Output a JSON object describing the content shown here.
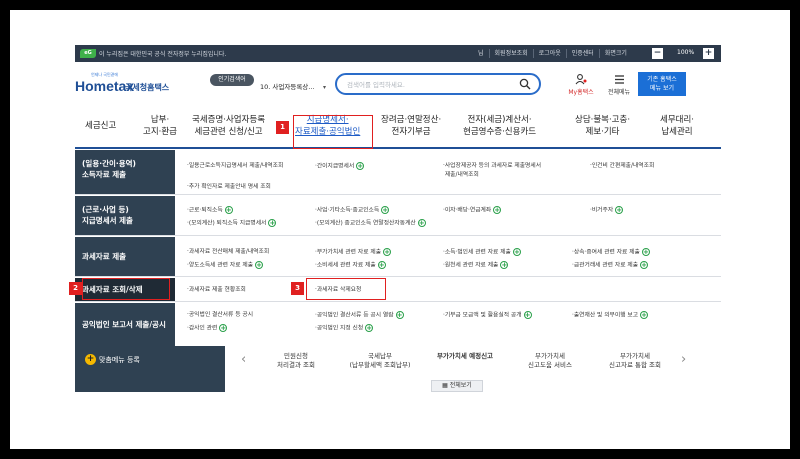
{
  "gov_bar": {
    "logo": "eG",
    "notice": "이 누리집은 대한민국 공식 전자정부 누리집입니다.",
    "links": [
      "님",
      "회원정보조회",
      "로그아웃",
      "인증센터",
      "화면크기"
    ],
    "zoom_minus": "−",
    "zoom_value": "100%",
    "zoom_plus": "+"
  },
  "header": {
    "logo_text": "Hometax",
    "logo_sub": "국세청홈택스",
    "logo_tiny": "언제나 국민곁에",
    "popular_label": "인기검색어",
    "popular_keyword": "10. 사업자등록상...",
    "search_placeholder": "검색어를 입력하세요.",
    "my_label": "My홈택스",
    "menu_label": "전체메뉴",
    "tax_btn_line1": "기존 홈택스",
    "tax_btn_line2": "메뉴 보기"
  },
  "gnb": [
    {
      "l1": "세금신고",
      "l2": ""
    },
    {
      "l1": "납부·",
      "l2": "고지·환급"
    },
    {
      "l1": "국세증명·사업자등록",
      "l2": "세금관련 신청/신고"
    },
    {
      "l1": "지급명세서·",
      "l2": "자료제출·공익법인"
    },
    {
      "l1": "장려금·연말정산·",
      "l2": "전자기부금"
    },
    {
      "l1": "전자(세금)계산서·",
      "l2": "현금영수증·신용카드"
    },
    {
      "l1": "상담·불복·고충·",
      "l2": "제보·기타"
    },
    {
      "l1": "세무대리·",
      "l2": "납세관리"
    }
  ],
  "badges": {
    "b1": "1",
    "b2": "2",
    "b3": "3"
  },
  "menu": {
    "r1": {
      "cat1": "(일용·간이·용역)",
      "cat2": "소득자료 제출",
      "items": [
        "일용근로소득지급명세서 제출/내역조회",
        "간이지급명세서",
        "사업장제공자 등의 과세자료 제출명세서",
        "제출/내역조회",
        "인건비 간편제출/내역조회",
        "추가 확인자료 제출안내 명세 조회"
      ]
    },
    "r2": {
      "cat1": "(근로·사업 등)",
      "cat2": "지급명세서 제출",
      "items": [
        "근로·퇴직소득",
        "사업·기타소득·종교인소득",
        "이자·배당·연금계좌",
        "비거주자",
        "(모의계산) 퇴직소득 지급명세서",
        "(모의계산) 종교인소득 연말정산자동계산"
      ]
    },
    "r3": {
      "cat": "과세자료 제출",
      "items": [
        "과세자료 전산매체 제출/내역조회",
        "부가가치세 관련 자료 제출",
        "소득·법인세 관련 자료 제출",
        "상속·증여세 관련 자료 제출",
        "양도소득세 관련 자료 제출",
        "소비세세 관련 자료 제출",
        "원천세 관련 자료 제출",
        "금관거래세 관련 자료 제출"
      ]
    },
    "r4": {
      "cat": "과세자료 조회/삭제",
      "items": [
        "과세자료 제출 현황조회",
        "과세자료 삭제요청"
      ]
    },
    "r5": {
      "cat": "공익법인 보고서 제출/공시",
      "items": [
        "공익법인 결산서류 등 공시",
        "공익법인 결산서류 등 공시 열람",
        "기부금 모금액 및 활용실적 공개",
        "출연재산 및 의무이행 보고",
        "감사인 관련",
        "공익법인 지정 신청"
      ]
    }
  },
  "bottom": {
    "fav_label": "맞춤메뉴 등록",
    "quick": [
      {
        "l1": "민원신청",
        "l2": "처리결과 조회"
      },
      {
        "l1": "국세납부",
        "l2": "(납부할세액 조회납부)"
      },
      {
        "l1": "부가가치세 예정신고",
        "l2": ""
      },
      {
        "l1": "부가가치세",
        "l2": "신고도움 서비스"
      },
      {
        "l1": "부가가치세",
        "l2": "신고자료 통합 조회"
      }
    ],
    "view_all": "전체보기"
  }
}
